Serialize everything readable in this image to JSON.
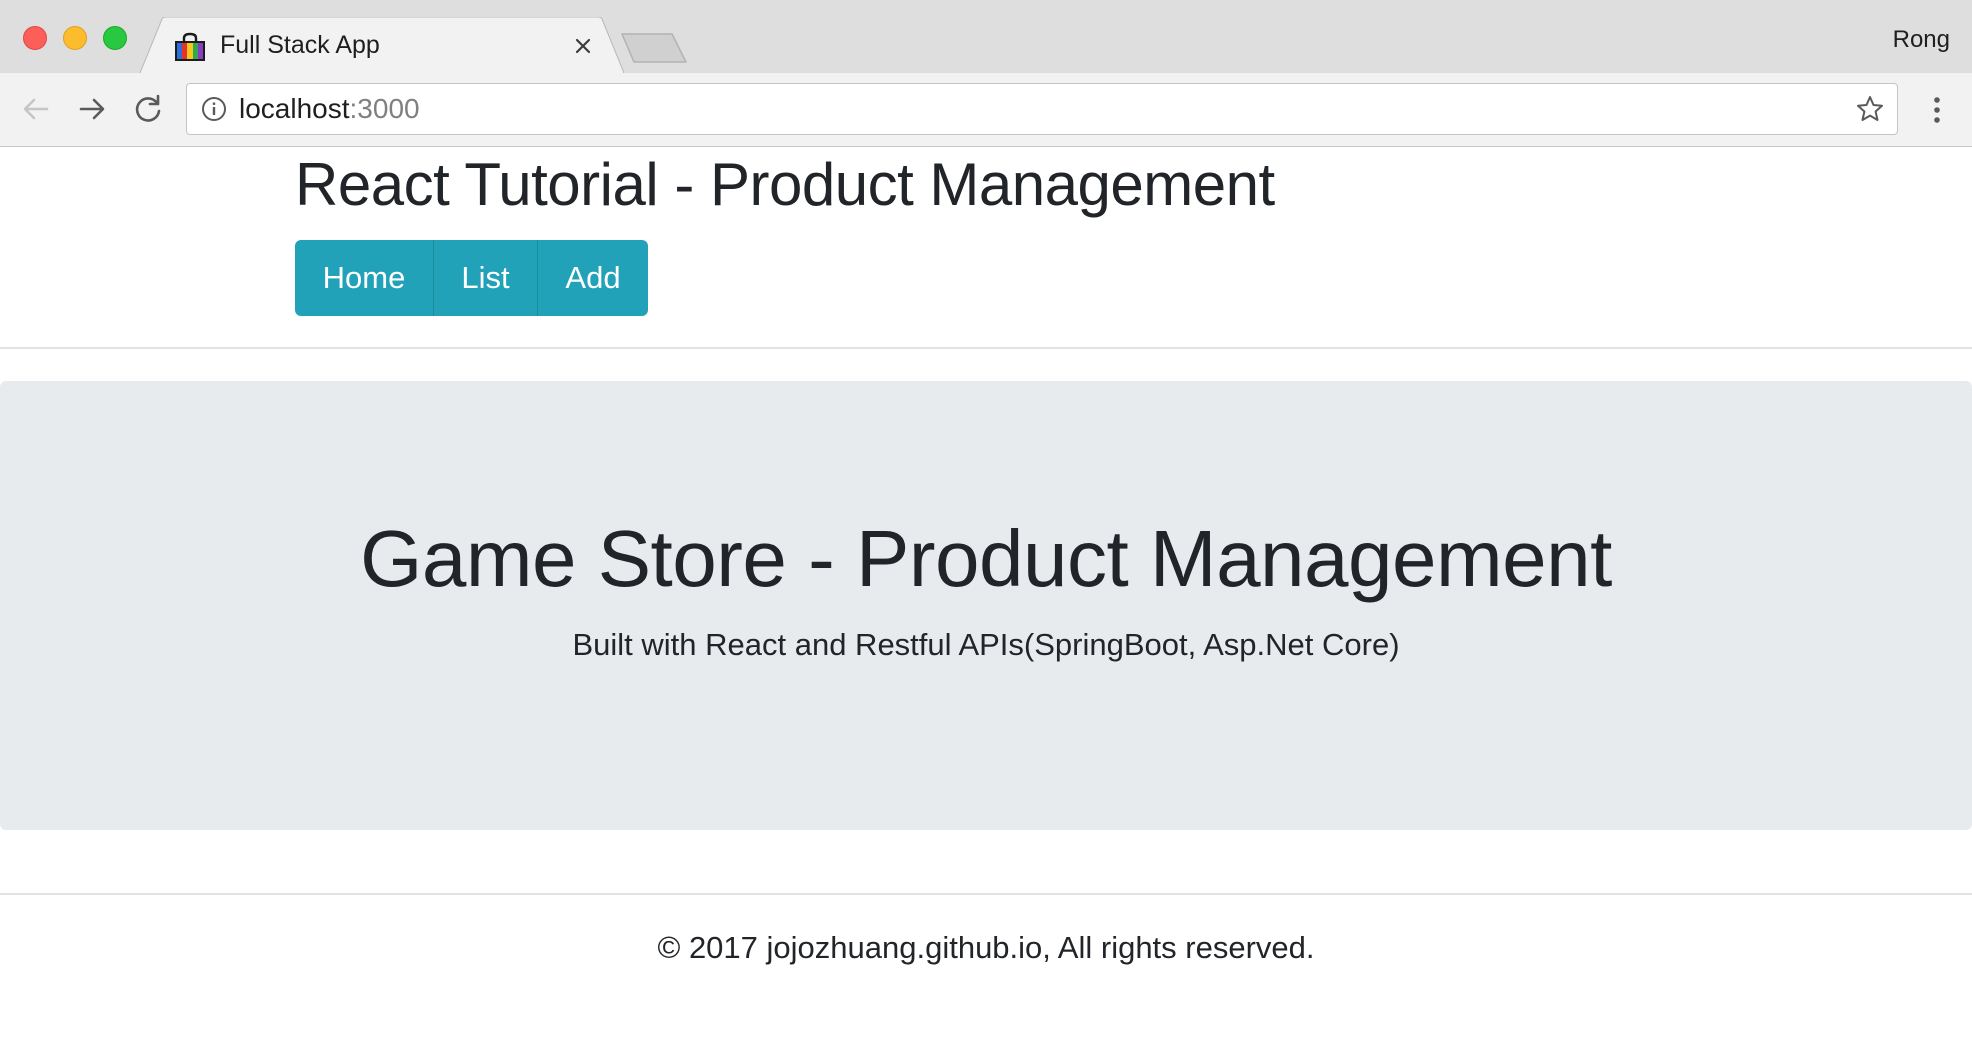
{
  "browser": {
    "tab_title": "Full Stack App",
    "profile_name": "Rong",
    "url_host": "localhost",
    "url_port": ":3000",
    "accent_color": "#22a2b8"
  },
  "header": {
    "title": "React Tutorial - Product Management",
    "nav": [
      {
        "label": "Home"
      },
      {
        "label": "List"
      },
      {
        "label": "Add"
      }
    ]
  },
  "jumbotron": {
    "title": "Game Store - Product Management",
    "subtitle": "Built with React and Restful APIs(SpringBoot, Asp.Net Core)"
  },
  "footer": {
    "text": "© 2017 jojozhuang.github.io, All rights reserved."
  },
  "icons": [
    "close-icon",
    "back-arrow-icon",
    "forward-arrow-icon",
    "reload-icon",
    "info-icon",
    "star-icon",
    "more-vert-icon",
    "shopping-bag-icon"
  ]
}
